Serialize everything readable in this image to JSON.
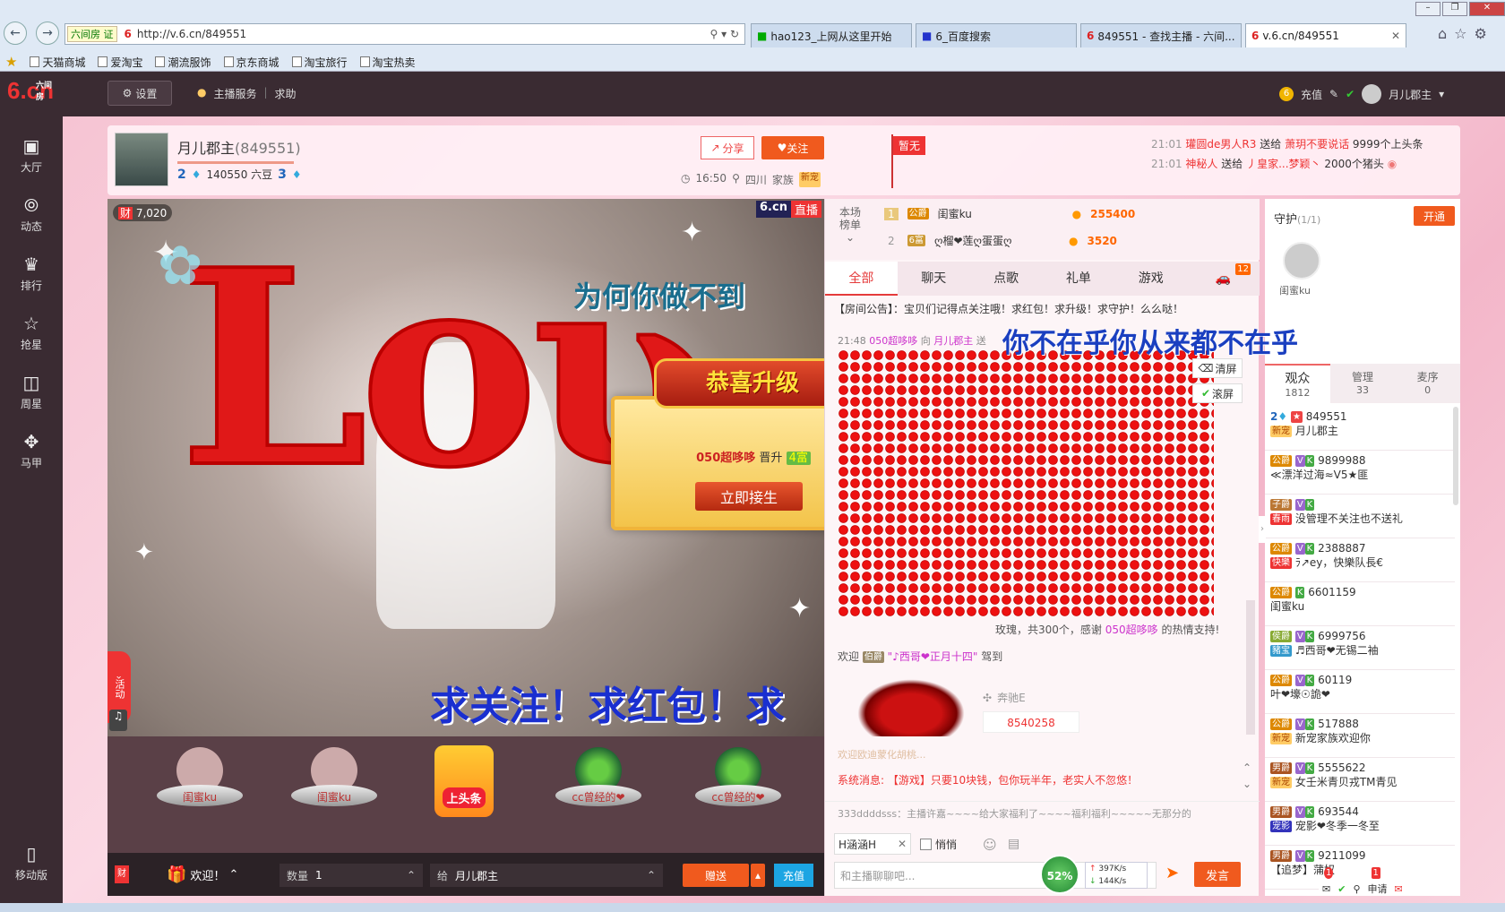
{
  "browser": {
    "url": "http://v.6.cn/849551",
    "site_tag": "六间房",
    "site_tag_suffix": "证",
    "tabs": [
      {
        "label": "hao123_上网从这里开始"
      },
      {
        "label": "6_百度搜索"
      },
      {
        "label": "849551 - 查找主播 - 六间..."
      },
      {
        "label": "v.6.cn/849551"
      }
    ],
    "favorites": [
      "天猫商城",
      "爱淘宝",
      "潮流服饰",
      "京东商城",
      "淘宝旅行",
      "淘宝热卖"
    ]
  },
  "site": {
    "logo_text": "6.cn",
    "logo_sub": "六间房",
    "settings_label": "设置",
    "anchor_service": "主播服务",
    "help": "求助",
    "recharge": "充值",
    "username": "月儿郡主"
  },
  "leftnav": [
    {
      "label": "大厅",
      "icon": "tv-icon"
    },
    {
      "label": "动态",
      "icon": "compass-icon"
    },
    {
      "label": "排行",
      "icon": "crown-icon"
    },
    {
      "label": "抢星",
      "icon": "star-icon"
    },
    {
      "label": "周星",
      "icon": "bag-icon"
    },
    {
      "label": "马甲",
      "icon": "shirt-icon"
    }
  ],
  "mobile_label": "移动版",
  "anchor": {
    "name": "月儿郡主",
    "room_id": "(849551)",
    "level": "2",
    "beans": "140550 六豆",
    "fans_level": "3",
    "time": "16:50",
    "location": "四川",
    "family_label": "家族",
    "family_badge": "新宠",
    "share": "分享",
    "follow": "关注",
    "status": "暂无"
  },
  "ticker": [
    {
      "time": "21:01",
      "from": "瓘圆de男人R3",
      "action": "送给",
      "to": "萧玥不要说话",
      "gift": "9999个上头条"
    },
    {
      "time": "21:01",
      "from": "神秘人",
      "action": "送给",
      "to": "丿皇家...梦颖丶",
      "gift": "2000个猪头"
    }
  ],
  "video": {
    "wealth": "7,020",
    "wealth_label": "财",
    "brand": "6.cn",
    "live": "直播",
    "lyric1": "为何你做不到",
    "lyric2": "你不在乎你从来都不在乎",
    "rose_text": "Loʋ",
    "banner": "求关注！求红包！求",
    "activity": "活动",
    "popup": {
      "title": "恭喜升级",
      "user": "050超哆哆",
      "action": "晋升",
      "level": "4富",
      "button": "立即接生"
    }
  },
  "gifts": [
    {
      "label": "闺蜜ku"
    },
    {
      "label": "闺蜜ku"
    },
    {
      "label": "上头条"
    },
    {
      "label": "cc曾经的❤"
    },
    {
      "label": "cc曾经的❤"
    }
  ],
  "inputbar": {
    "welcome": "欢迎！",
    "qty_label": "数量",
    "qty_value": "1",
    "to_label": "给",
    "to_value": "月儿郡主",
    "give": "赠送",
    "recharge": "充值"
  },
  "rank": {
    "label1": "本场",
    "label2": "榜单",
    "rows": [
      {
        "rank": "1",
        "name": "闺蜜ku",
        "score": "255400"
      },
      {
        "rank": "2",
        "name": "ღ榴❤莲ღ蛋蛋ღ",
        "score": "3520"
      }
    ]
  },
  "chat": {
    "tabs": [
      "全部",
      "聊天",
      "点歌",
      "礼单",
      "游戏"
    ],
    "car_count": "12",
    "announcement": "【房间公告】：宝贝们记得点关注哦！求红包！求升级！求守护！么么哒！",
    "gift_msg": {
      "time": "21:48",
      "from": "050超哆哆",
      "verb": "向",
      "to": "月儿郡主",
      "action": "送"
    },
    "rose_thanks_pre": "玫瑰，共300个，感谢",
    "rose_thanks_user": "050超哆哆",
    "rose_thanks_post": "的热情支持!",
    "clear": "清屏",
    "scroll": "滚屏",
    "welcome_pre": "欢迎",
    "welcome_user": "\"♪西哥❤正月十四\"",
    "welcome_post": "驾到",
    "car_brand": "奔驰E",
    "car_price": "8540258",
    "sys_msg": "系统消息: 【游戏】只要10块钱，包你玩半年，老实人不忽悠！",
    "partial_msg": "欢迎欧迪蒙化胡桃...",
    "bottom_msg": "333ddddsss：主播许嘉~~~~给大家福利了~~~~福利福利~~~~~无那分的",
    "chat_target": "H涵涵H",
    "whisper": "悄悄",
    "placeholder": "和主播聊聊吧...",
    "send": "发言",
    "cpu": "52%",
    "up_speed": "397K/s",
    "down_speed": "144K/s"
  },
  "guard": {
    "title": "守护",
    "count": "(1/1)",
    "open": "开通",
    "member": "闺蜜ku",
    "tabs": [
      {
        "label": "观众",
        "count": "1812"
      },
      {
        "label": "管理",
        "count": "33"
      },
      {
        "label": "麦序",
        "count": "0"
      }
    ],
    "users": [
      {
        "badge": "2",
        "id": "849551",
        "name": "月儿郡主",
        "tag": "新宠"
      },
      {
        "badge": "公爵",
        "id": "9899988",
        "name": "≪漂洋过海≈V5★匪"
      },
      {
        "badge": "子爵",
        "id": "",
        "name": "没管理不关注也不送礼",
        "tag": "春雨"
      },
      {
        "badge": "公爵",
        "id": "2388887",
        "name": "ﾗ↗ey，快樂队長€",
        "tag": "快樂"
      },
      {
        "badge": "公爵",
        "id": "6601159",
        "name": "闺蜜ku"
      },
      {
        "badge": "侯爵",
        "id": "6999756",
        "name": "♬西哥❤无锡二袖",
        "tag": "豬宝"
      },
      {
        "badge": "公爵",
        "id": "60119",
        "name": "叶❤壕☉詭❤"
      },
      {
        "badge": "公爵",
        "id": "517888",
        "name": "新宠家族欢迎你",
        "tag": "新宠"
      },
      {
        "badge": "男爵",
        "id": "5555622",
        "name": "女壬米青贝戎TM青见",
        "tag": "新宠"
      },
      {
        "badge": "男爵",
        "id": "693544",
        "name": "宠影❤冬季一冬至",
        "tag": "宠影"
      },
      {
        "badge": "男爵",
        "id": "9211099",
        "name": "【追梦】蒲奴"
      }
    ],
    "notif1": "1",
    "notif2": "1",
    "apply": "申请"
  }
}
